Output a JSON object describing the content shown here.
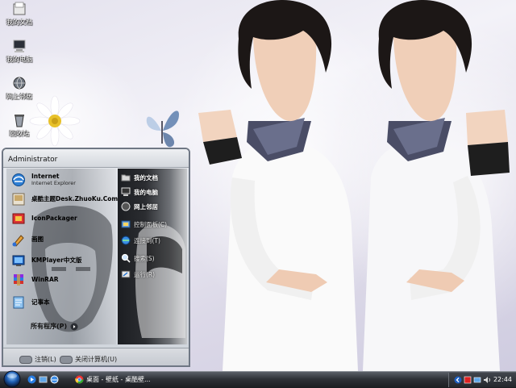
{
  "desktop": {
    "icons": [
      {
        "label": "我的文档",
        "icon": "my-documents-icon"
      },
      {
        "label": "我的电脑",
        "icon": "my-computer-icon"
      },
      {
        "label": "网上邻居",
        "icon": "network-places-icon"
      },
      {
        "label": "回收站",
        "icon": "recycle-bin-icon"
      }
    ]
  },
  "start_menu": {
    "user": "Administrator",
    "programs": [
      {
        "title": "Internet",
        "subtitle": "Internet Explorer",
        "icon": "internet-explorer-icon"
      },
      {
        "title": "桌酷主题Desk.ZhuoKu.Com",
        "subtitle": "",
        "icon": "zhuoku-theme-icon"
      },
      {
        "title": "IconPackager",
        "subtitle": "",
        "icon": "iconpackager-icon"
      },
      {
        "title": "画图",
        "subtitle": "",
        "icon": "paint-icon"
      },
      {
        "title": "KMPlayer中文版",
        "subtitle": "",
        "icon": "kmplayer-icon"
      },
      {
        "title": "WinRAR",
        "subtitle": "",
        "icon": "winrar-icon"
      },
      {
        "title": "记事本",
        "subtitle": "",
        "icon": "notepad-icon"
      }
    ],
    "all_programs": "所有程序(P)",
    "places": [
      {
        "label": "我的文档",
        "icon": "folder-icon"
      },
      {
        "label": "我的电脑",
        "icon": "computer-icon"
      },
      {
        "label": "网上邻居",
        "icon": "network-icon"
      },
      {
        "label": "控制面板(C)",
        "icon": "control-panel-icon"
      },
      {
        "label": "连接到(T)",
        "icon": "connect-icon"
      },
      {
        "label": "搜索(S)",
        "icon": "search-icon"
      },
      {
        "label": "运行(R)",
        "icon": "run-icon"
      }
    ],
    "footer": {
      "logoff": "注销(L)",
      "shutdown": "关闭计算机(U)"
    }
  },
  "taskbar": {
    "task_button": "桌面 - 壁纸 - 桌酷壁...",
    "clock": "22:44"
  },
  "colors": {
    "taskbar_top": "#5b6068",
    "taskbar_bottom": "#1b1d21",
    "start_menu_border": "#6f7784"
  }
}
